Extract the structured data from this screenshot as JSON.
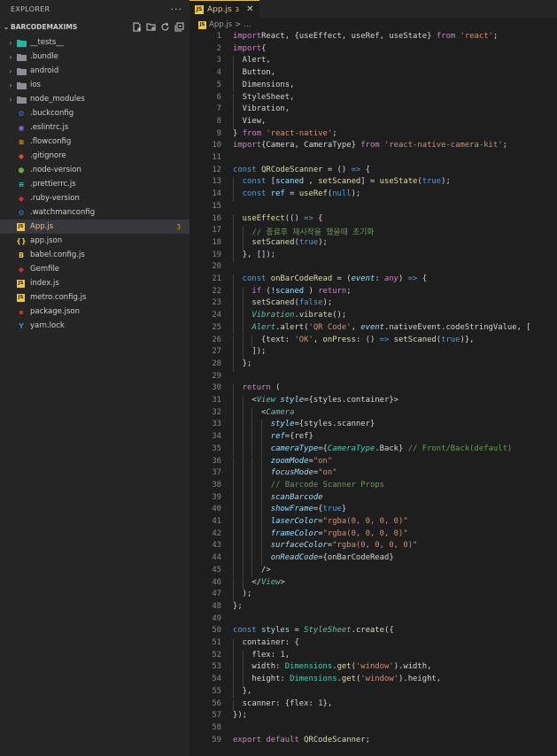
{
  "sidebar": {
    "title": "EXPLORER",
    "more": "···",
    "project": "BARCODEMAXIMS",
    "items": [
      {
        "label": "__tests__",
        "type": "folder",
        "icon": "folder-icon",
        "color": "#29b3a1"
      },
      {
        "label": ".bundle",
        "type": "folder",
        "icon": "folder-icon",
        "color": "#8a8f98"
      },
      {
        "label": "android",
        "type": "folder",
        "icon": "folder-icon",
        "color": "#8a8f98"
      },
      {
        "label": "ios",
        "type": "folder",
        "icon": "folder-icon",
        "color": "#8a8f98"
      },
      {
        "label": "node_modules",
        "type": "folder",
        "icon": "folder-icon",
        "color": "#8a8f98"
      },
      {
        "label": ".buckconfig",
        "type": "file",
        "icon": "config-icon",
        "color": "#3a77c4"
      },
      {
        "label": ".eslintrc.js",
        "type": "file",
        "icon": "eslint-icon",
        "color": "#7c6fe0"
      },
      {
        "label": ".flowconfig",
        "type": "file",
        "icon": "flow-icon",
        "color": "#e2a732"
      },
      {
        "label": ".gitignore",
        "type": "file",
        "icon": "git-icon",
        "color": "#e04d2f"
      },
      {
        "label": ".node-version",
        "type": "file",
        "icon": "node-icon",
        "color": "#6aa84f"
      },
      {
        "label": ".prettierrc.js",
        "type": "file",
        "icon": "prettier-icon",
        "color": "#56b3b4"
      },
      {
        "label": ".ruby-version",
        "type": "file",
        "icon": "ruby-icon",
        "color": "#cc3333"
      },
      {
        "label": ".watchmanconfig",
        "type": "file",
        "icon": "config-icon",
        "color": "#3a77c4"
      },
      {
        "label": "App.js",
        "type": "file",
        "icon": "js-icon",
        "color": "#e8c64f",
        "selected": true,
        "badge": "3"
      },
      {
        "label": "app.json",
        "type": "file",
        "icon": "json-icon",
        "color": "#e8c64f"
      },
      {
        "label": "babel.config.js",
        "type": "file",
        "icon": "babel-icon",
        "color": "#e8c64f"
      },
      {
        "label": "Gemfile",
        "type": "file",
        "icon": "ruby-icon",
        "color": "#cc3333"
      },
      {
        "label": "index.js",
        "type": "file",
        "icon": "js-icon",
        "color": "#e8c64f"
      },
      {
        "label": "metro.config.js",
        "type": "file",
        "icon": "js-icon",
        "color": "#e8c64f"
      },
      {
        "label": "package.json",
        "type": "file",
        "icon": "npm-icon",
        "color": "#cc3333"
      },
      {
        "label": "yarn.lock",
        "type": "file",
        "icon": "yarn-icon",
        "color": "#2c8ebb"
      }
    ]
  },
  "editor": {
    "tab": {
      "name": "App.js",
      "count": "3",
      "close": "✕"
    },
    "breadcrumb": {
      "file": "App.js",
      "sep": ">",
      "more": "..."
    },
    "lines": [
      {
        "n": "1",
        "t": [
          [
            "kw",
            "import"
          ],
          [
            "",
            "React, {useEffect, useRef, useState} "
          ],
          [
            "kw",
            "from"
          ],
          [
            "st",
            " 'react'"
          ],
          [
            "",
            ";"
          ]
        ]
      },
      {
        "n": "2",
        "t": [
          [
            "kw",
            "import"
          ],
          [
            "",
            "{"
          ]
        ]
      },
      {
        "n": "3",
        "t": [
          [
            "",
            "  Alert,"
          ]
        ]
      },
      {
        "n": "4",
        "t": [
          [
            "",
            "  Button,"
          ]
        ]
      },
      {
        "n": "5",
        "t": [
          [
            "",
            "  Dimensions,"
          ]
        ]
      },
      {
        "n": "6",
        "t": [
          [
            "",
            "  StyleSheet,"
          ]
        ]
      },
      {
        "n": "7",
        "t": [
          [
            "",
            "  Vibration,"
          ]
        ]
      },
      {
        "n": "8",
        "t": [
          [
            "",
            "  View,"
          ]
        ]
      },
      {
        "n": "9",
        "t": [
          [
            "",
            "} "
          ],
          [
            "kw",
            "from"
          ],
          [
            "st",
            " 'react-native'"
          ],
          [
            "",
            ";"
          ]
        ]
      },
      {
        "n": "10",
        "t": [
          [
            "kw",
            "import"
          ],
          [
            "",
            "{Camera, CameraType} "
          ],
          [
            "kw",
            "from"
          ],
          [
            "st",
            " 'react-native-camera-kit'"
          ],
          [
            "",
            ";"
          ]
        ]
      },
      {
        "n": "11",
        "t": []
      },
      {
        "n": "12",
        "t": [
          [
            "kd",
            "const "
          ],
          [
            "fn",
            "QRCodeScanner"
          ],
          [
            "",
            " = () "
          ],
          [
            "kd",
            "=>"
          ],
          [
            "",
            " {"
          ]
        ]
      },
      {
        "n": "13",
        "t": [
          [
            "kd",
            "  const "
          ],
          [
            "",
            "["
          ],
          [
            "vr",
            "scaned"
          ],
          [
            "",
            " , "
          ],
          [
            "fn",
            "setScaned"
          ],
          [
            "",
            "] = "
          ],
          [
            "fn",
            "useState"
          ],
          [
            "",
            "("
          ],
          [
            "kd",
            "true"
          ],
          [
            "",
            ");"
          ]
        ]
      },
      {
        "n": "14",
        "t": [
          [
            "kd",
            "  const "
          ],
          [
            "vr",
            "ref"
          ],
          [
            "",
            " = "
          ],
          [
            "fn",
            "useRef"
          ],
          [
            "",
            "("
          ],
          [
            "kd",
            "null"
          ],
          [
            "",
            ");"
          ]
        ]
      },
      {
        "n": "15",
        "t": []
      },
      {
        "n": "16",
        "t": [
          [
            "fn",
            "  useEffect"
          ],
          [
            "",
            "(() "
          ],
          [
            "kd",
            "=>"
          ],
          [
            "",
            " {"
          ]
        ]
      },
      {
        "n": "17",
        "t": [
          [
            "cm",
            "    // 종료후 재시작을 했을때 초기화"
          ]
        ]
      },
      {
        "n": "18",
        "t": [
          [
            "fn",
            "    setScaned"
          ],
          [
            "",
            "("
          ],
          [
            "kd",
            "true"
          ],
          [
            "",
            ");"
          ]
        ]
      },
      {
        "n": "19",
        "t": [
          [
            "",
            "  }, []);"
          ]
        ]
      },
      {
        "n": "20",
        "t": []
      },
      {
        "n": "21",
        "t": [
          [
            "kd",
            "  const "
          ],
          [
            "fn",
            "onBarCodeRead"
          ],
          [
            "",
            " = ("
          ],
          [
            "vr it",
            "event"
          ],
          [
            "",
            ": "
          ],
          [
            "kw it",
            "any"
          ],
          [
            "",
            ") "
          ],
          [
            "kd",
            "=>"
          ],
          [
            "",
            " {"
          ]
        ]
      },
      {
        "n": "22",
        "t": [
          [
            "kw",
            "    if"
          ],
          [
            "",
            " (!"
          ],
          [
            "vr",
            "scaned"
          ],
          [
            "",
            " ) "
          ],
          [
            "kw",
            "return"
          ],
          [
            "",
            ";"
          ]
        ]
      },
      {
        "n": "23",
        "t": [
          [
            "fn",
            "    setScaned"
          ],
          [
            "",
            "("
          ],
          [
            "kd",
            "false"
          ],
          [
            "",
            ");"
          ]
        ]
      },
      {
        "n": "24",
        "t": [
          [
            "tp it",
            "    Vibration"
          ],
          [
            "",
            "."
          ],
          [
            "fn",
            "vibrate"
          ],
          [
            "",
            "();"
          ]
        ]
      },
      {
        "n": "25",
        "t": [
          [
            "tp it",
            "    Alert"
          ],
          [
            "",
            "."
          ],
          [
            "fn",
            "alert"
          ],
          [
            "",
            "("
          ],
          [
            "st",
            "'QR Code'"
          ],
          [
            "",
            ", "
          ],
          [
            "vr it",
            "event"
          ],
          [
            "",
            ".nativeEvent.codeStringValue, ["
          ]
        ]
      },
      {
        "n": "26",
        "t": [
          [
            "",
            "      {text: "
          ],
          [
            "st",
            "'OK'"
          ],
          [
            "",
            ", "
          ],
          [
            "fn",
            "onPress"
          ],
          [
            "",
            ": () "
          ],
          [
            "kd",
            "=>"
          ],
          [
            "fn",
            " setScaned"
          ],
          [
            "",
            "("
          ],
          [
            "kd",
            "true"
          ],
          [
            "",
            ")},"
          ]
        ]
      },
      {
        "n": "27",
        "t": [
          [
            "",
            "    ]);"
          ]
        ]
      },
      {
        "n": "28",
        "t": [
          [
            "",
            "  };"
          ]
        ]
      },
      {
        "n": "29",
        "t": []
      },
      {
        "n": "30",
        "t": [
          [
            "kw",
            "  return"
          ],
          [
            "",
            " ("
          ]
        ]
      },
      {
        "n": "31",
        "t": [
          [
            "",
            "    <"
          ],
          [
            "tp it",
            "View"
          ],
          [
            "vr it",
            " style"
          ],
          [
            "",
            "={styles.container}>"
          ]
        ]
      },
      {
        "n": "32",
        "t": [
          [
            "",
            "      <"
          ],
          [
            "tp it",
            "Camera"
          ]
        ]
      },
      {
        "n": "33",
        "t": [
          [
            "vr it",
            "        style"
          ],
          [
            "",
            "={styles.scanner}"
          ]
        ]
      },
      {
        "n": "34",
        "t": [
          [
            "vr it",
            "        ref"
          ],
          [
            "",
            "={ref}"
          ]
        ]
      },
      {
        "n": "35",
        "t": [
          [
            "vr it",
            "        cameraType"
          ],
          [
            "",
            "={"
          ],
          [
            "tp it",
            "CameraType"
          ],
          [
            "",
            ".Back} "
          ],
          [
            "cm",
            "// Front/Back(default)"
          ]
        ]
      },
      {
        "n": "36",
        "t": [
          [
            "vr it",
            "        zoomMode"
          ],
          [
            "",
            "="
          ],
          [
            "st",
            "\"on\""
          ]
        ]
      },
      {
        "n": "37",
        "t": [
          [
            "vr it",
            "        focusMode"
          ],
          [
            "",
            "="
          ],
          [
            "st",
            "\"on\""
          ]
        ]
      },
      {
        "n": "38",
        "t": [
          [
            "cm",
            "        // Barcode Scanner Props"
          ]
        ]
      },
      {
        "n": "39",
        "t": [
          [
            "vr it",
            "        scanBarcode"
          ]
        ]
      },
      {
        "n": "40",
        "t": [
          [
            "vr it",
            "        showFrame"
          ],
          [
            "",
            "={"
          ],
          [
            "kd",
            "true"
          ],
          [
            "",
            "}"
          ]
        ]
      },
      {
        "n": "41",
        "t": [
          [
            "vr it",
            "        laserColor"
          ],
          [
            "",
            "="
          ],
          [
            "st",
            "\"rgba(0, 0, 0, 0)\""
          ]
        ]
      },
      {
        "n": "42",
        "t": [
          [
            "vr it",
            "        frameColor"
          ],
          [
            "",
            "="
          ],
          [
            "st",
            "\"rgba(0, 0, 0, 0)\""
          ]
        ]
      },
      {
        "n": "43",
        "t": [
          [
            "vr it",
            "        surfaceColor"
          ],
          [
            "",
            "="
          ],
          [
            "st",
            "\"rgba(0, 0, 0, 0)\""
          ]
        ]
      },
      {
        "n": "44",
        "t": [
          [
            "vr it",
            "        onReadCode"
          ],
          [
            "",
            "={onBarCodeRead}"
          ]
        ]
      },
      {
        "n": "45",
        "t": [
          [
            "",
            "      />"
          ]
        ]
      },
      {
        "n": "46",
        "t": [
          [
            "",
            "    </"
          ],
          [
            "tp it",
            "View"
          ],
          [
            "",
            ">"
          ]
        ]
      },
      {
        "n": "47",
        "t": [
          [
            "",
            "  );"
          ]
        ]
      },
      {
        "n": "48",
        "t": [
          [
            "",
            "};"
          ]
        ]
      },
      {
        "n": "49",
        "t": []
      },
      {
        "n": "50",
        "t": [
          [
            "kd",
            "const "
          ],
          [
            "vr",
            "styles"
          ],
          [
            "",
            " = "
          ],
          [
            "tp it",
            "StyleSheet"
          ],
          [
            "",
            "."
          ],
          [
            "fn",
            "create"
          ],
          [
            "",
            "({"
          ]
        ]
      },
      {
        "n": "51",
        "t": [
          [
            "",
            "  container: {"
          ]
        ]
      },
      {
        "n": "52",
        "t": [
          [
            "",
            "    flex: "
          ],
          [
            "nm",
            "1"
          ],
          [
            "",
            ","
          ]
        ]
      },
      {
        "n": "53",
        "t": [
          [
            "",
            "    width: "
          ],
          [
            "tp",
            "Dimensions"
          ],
          [
            "",
            "."
          ],
          [
            "fn",
            "get"
          ],
          [
            "",
            "("
          ],
          [
            "st",
            "'window'"
          ],
          [
            "",
            ").width,"
          ]
        ]
      },
      {
        "n": "54",
        "t": [
          [
            "",
            "    height: "
          ],
          [
            "tp",
            "Dimensions"
          ],
          [
            "",
            "."
          ],
          [
            "fn",
            "get"
          ],
          [
            "",
            "("
          ],
          [
            "st",
            "'window'"
          ],
          [
            "",
            ").height,"
          ]
        ]
      },
      {
        "n": "55",
        "t": [
          [
            "",
            "  },"
          ]
        ]
      },
      {
        "n": "56",
        "t": [
          [
            "",
            "  scanner: {flex: "
          ],
          [
            "nm",
            "1"
          ],
          [
            "",
            "},"
          ]
        ]
      },
      {
        "n": "57",
        "t": [
          [
            "",
            "});"
          ]
        ]
      },
      {
        "n": "58",
        "t": []
      },
      {
        "n": "59",
        "t": [
          [
            "kw",
            "export"
          ],
          [
            "kw",
            " default"
          ],
          [
            "fn",
            " QRCodeScanner"
          ],
          [
            "",
            ";"
          ]
        ]
      }
    ]
  }
}
